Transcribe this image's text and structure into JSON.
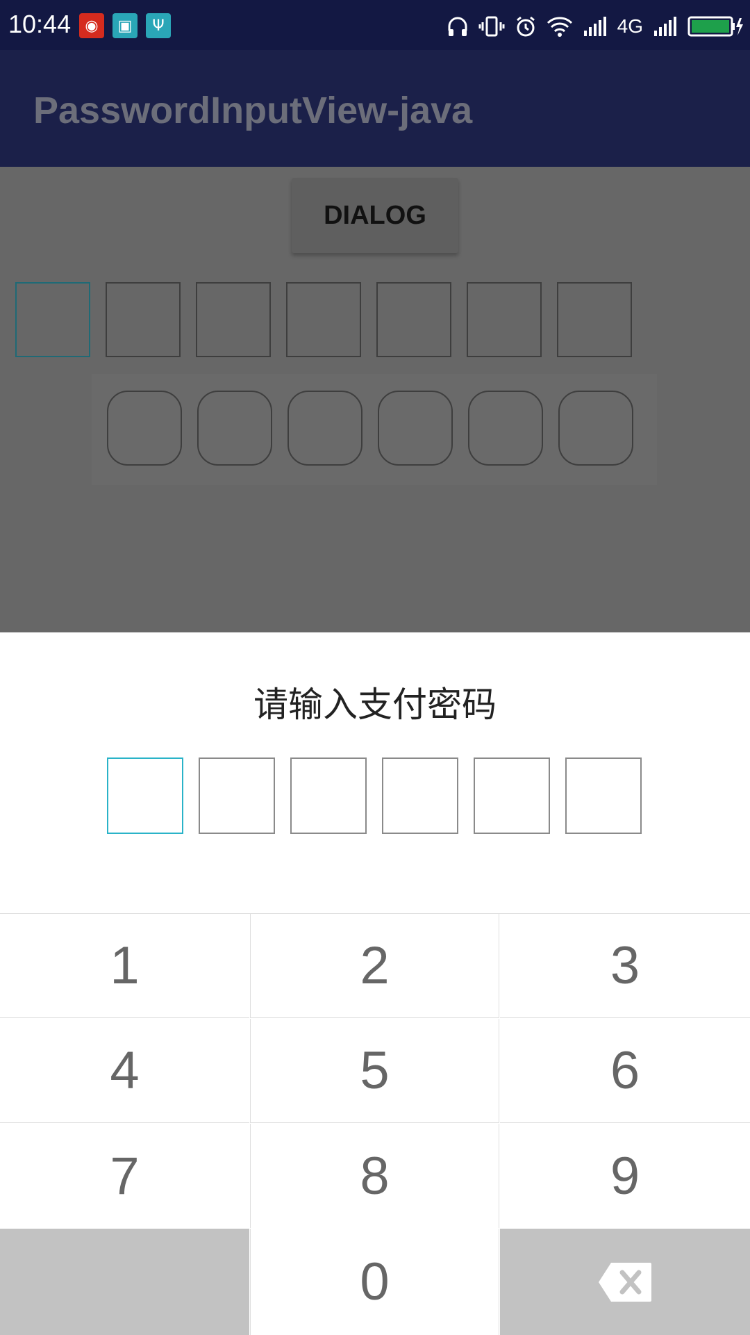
{
  "status_bar": {
    "time": "10:44",
    "network": "4G",
    "icons": [
      "netease-music-icon",
      "screenshot-icon",
      "usb-icon",
      "headphones-icon",
      "vibrate-icon",
      "alarm-icon",
      "wifi-icon",
      "signal-icon",
      "signal-icon",
      "battery-icon"
    ],
    "battery_color": "#1ea04b"
  },
  "app_bar": {
    "title": "PasswordInputView-java",
    "background": "#1b2049"
  },
  "content": {
    "dialog_button": "DIALOG",
    "square_boxes_count": 7,
    "rounded_boxes_count": 6,
    "active_border_color": "#1f6a76"
  },
  "sheet": {
    "title": "请输入支付密码",
    "password_length": 6,
    "active_border_color": "#2ab3c8"
  },
  "keypad": {
    "keys": [
      "1",
      "2",
      "3",
      "4",
      "5",
      "6",
      "7",
      "8",
      "9",
      "0"
    ],
    "backspace_icon": "backspace-icon"
  }
}
